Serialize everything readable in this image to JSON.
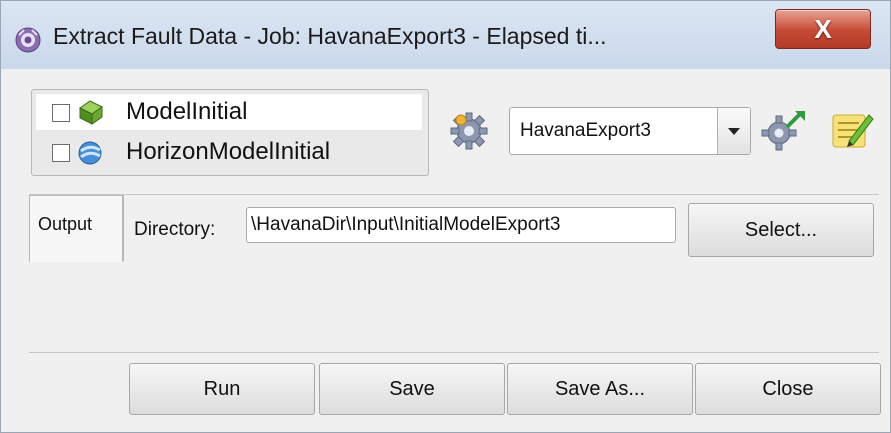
{
  "window": {
    "title": "Extract Fault Data - Job: HavanaExport3 - Elapsed ti...",
    "close_label": "X",
    "app_icon": "app-logo-icon",
    "close_icon": "close-icon"
  },
  "tree": {
    "items": [
      {
        "label": "ModelInitial",
        "checked": false,
        "icon": "model-cube-icon"
      },
      {
        "label": "HorizonModelInitial",
        "checked": false,
        "icon": "horizon-model-icon"
      }
    ]
  },
  "toolbar": {
    "settings_icon": "gear-icon",
    "job_select_value": "HavanaExport3",
    "job_settings_icon": "gear-export-icon",
    "edit_icon": "edit-notes-icon"
  },
  "tabs": [
    {
      "label": "Output"
    }
  ],
  "output": {
    "directory_label": "Directory:",
    "directory_value": "\\HavanaDir\\Input\\InitialModelExport3",
    "select_label": "Select..."
  },
  "actions": {
    "run_label": "Run",
    "save_label": "Save",
    "save_as_label": "Save As...",
    "close_label": "Close"
  },
  "colors": {
    "close_button": "#c64a35",
    "titlebar": "#c9d8ea"
  }
}
